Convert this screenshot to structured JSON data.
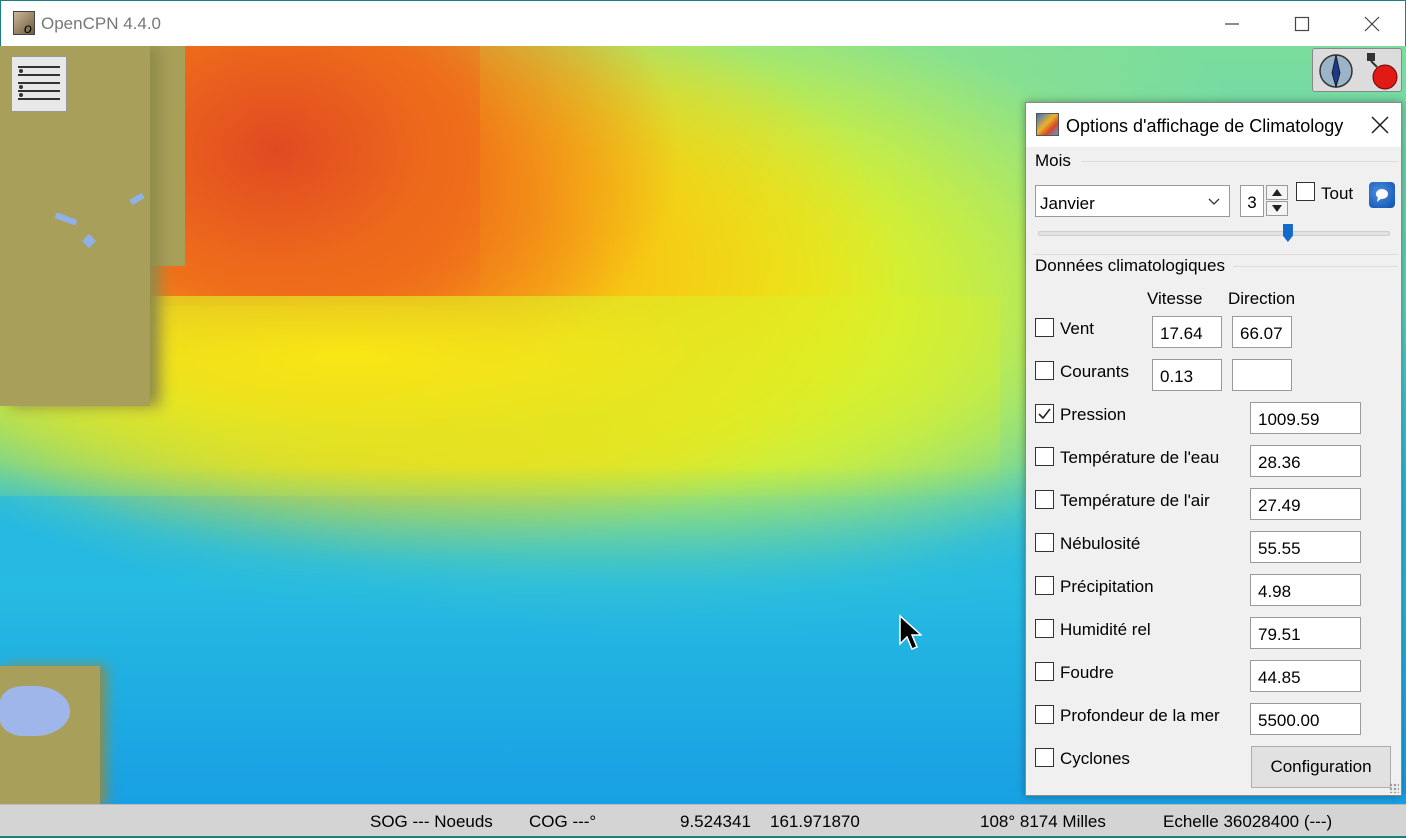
{
  "window": {
    "title": "OpenCPN 4.4.0"
  },
  "statusbar": {
    "sog": "SOG --- Noeuds",
    "cog": "COG ---°",
    "lat": "9.524341",
    "lon": "161.971870",
    "bearing_distance": "108°  8174 Milles",
    "scale": "Echelle 36028400 (---)"
  },
  "dialog": {
    "title": "Options d'affichage de Climatology",
    "month_section": "Mois",
    "month_value": "Janvier",
    "spin_value": "3",
    "all_label": "Tout",
    "month_slider_fraction": 0.71,
    "data_section": "Données climatologiques",
    "col_speed": "Vitesse",
    "col_direction": "Direction",
    "rows": [
      {
        "label": "Vent",
        "checked": false,
        "speed": "17.64",
        "direction": "66.07"
      },
      {
        "label": "Courants",
        "checked": false,
        "speed": "0.13",
        "direction": ""
      },
      {
        "label": "Pression",
        "checked": true,
        "value": "1009.59"
      },
      {
        "label": "Température de l'eau",
        "checked": false,
        "value": "28.36"
      },
      {
        "label": "Température de l'air",
        "checked": false,
        "value": "27.49"
      },
      {
        "label": "Nébulosité",
        "checked": false,
        "value": "55.55"
      },
      {
        "label": "Précipitation",
        "checked": false,
        "value": "4.98"
      },
      {
        "label": "Humidité rel",
        "checked": false,
        "value": "79.51"
      },
      {
        "label": "Foudre",
        "checked": false,
        "value": "44.85"
      },
      {
        "label": "Profondeur de la mer",
        "checked": false,
        "value": "5500.00"
      },
      {
        "label": "Cyclones",
        "checked": false
      }
    ],
    "config_button": "Configuration"
  },
  "icons": {
    "app": "opencpn-app-icon",
    "menu": "chart-menu-icon",
    "compass": "compass-icon",
    "record": "record-icon",
    "minimize": "minimize-icon",
    "maximize": "maximize-icon",
    "close": "close-icon",
    "dialog": "climatology-icon",
    "notification": "speech-bubble-icon"
  }
}
